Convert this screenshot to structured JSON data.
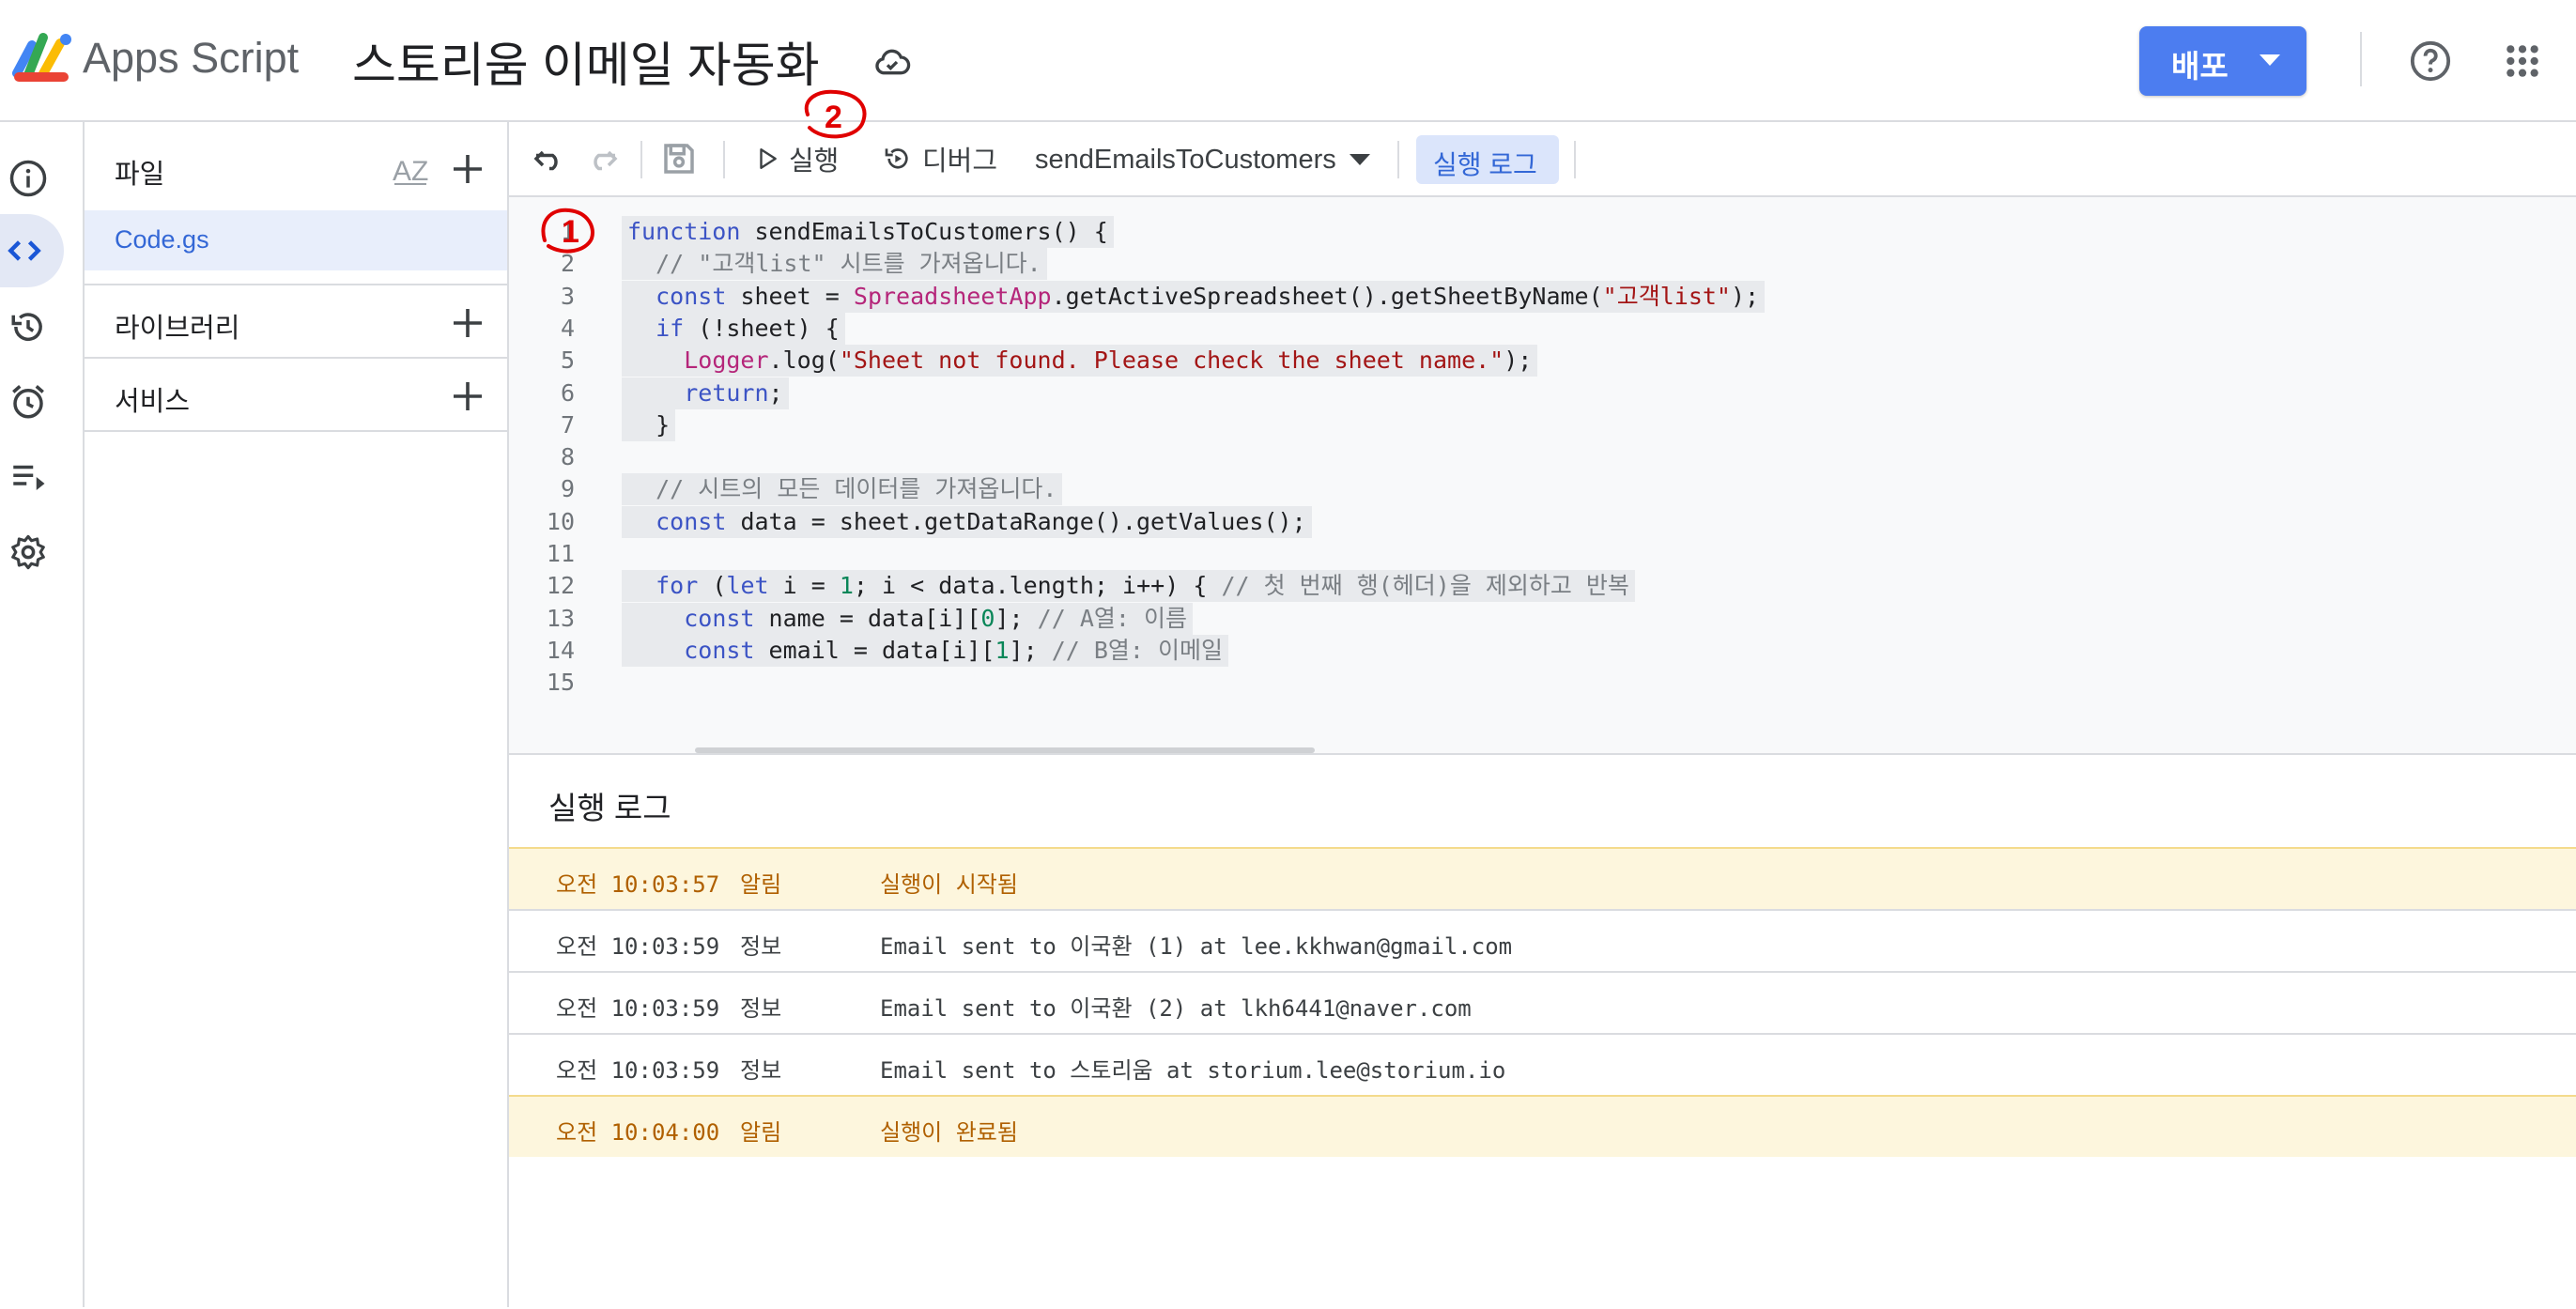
{
  "header": {
    "app_name": "Apps Script",
    "project_title": "스토리움 이메일 자동화",
    "deploy_label": "배포"
  },
  "icons": {
    "logo": "apps-script-logo",
    "cloud": "cloud-saved-icon",
    "help": "help-icon",
    "apps": "google-apps-grid-icon"
  },
  "files_panel": {
    "files_label": "파일",
    "files": [
      {
        "name": "Code.gs",
        "selected": true
      }
    ],
    "libraries_label": "라이브러리",
    "services_label": "서비스"
  },
  "toolbar": {
    "run_label": "실행",
    "debug_label": "디버그",
    "function_name": "sendEmailsToCustomers",
    "exec_log_label": "실행 로그"
  },
  "code": {
    "line_numbers": [
      "1",
      "2",
      "3",
      "4",
      "5",
      "6",
      "7",
      "8",
      "9",
      "10",
      "11",
      "12",
      "13",
      "14",
      "15"
    ],
    "lines": [
      "function sendEmailsToCustomers() {",
      "  // \"고객list\" 시트를 가져옵니다.",
      "  const sheet = SpreadsheetApp.getActiveSpreadsheet().getSheetByName(\"고객list\");",
      "  if (!sheet) {",
      "    Logger.log(\"Sheet not found. Please check the sheet name.\");",
      "    return;",
      "  }",
      "",
      "  // 시트의 모든 데이터를 가져옵니다.",
      "  const data = sheet.getDataRange().getValues();",
      "",
      "  for (let i = 1; i < data.length; i++) { // 첫 번째 행(헤더)을 제외하고 반복",
      "    const name = data[i][0]; // A열: 이름",
      "    const email = data[i][1]; // B열: 이메일",
      ""
    ]
  },
  "log": {
    "title": "실행 로그",
    "entries": [
      {
        "time": "오전 10:03:57",
        "level": "알림",
        "message": "실행이 시작됨",
        "type": "notice"
      },
      {
        "time": "오전 10:03:59",
        "level": "정보",
        "message": "Email sent to 이국환 (1) at lee.kkhwan@gmail.com",
        "type": "info"
      },
      {
        "time": "오전 10:03:59",
        "level": "정보",
        "message": "Email sent to 이국환 (2) at lkh6441@naver.com",
        "type": "info"
      },
      {
        "time": "오전 10:03:59",
        "level": "정보",
        "message": "Email sent to 스토리움 at storium.lee@storium.io",
        "type": "info"
      },
      {
        "time": "오전 10:04:00",
        "level": "알림",
        "message": "실행이 완료됨",
        "type": "notice"
      }
    ]
  },
  "annotations": [
    {
      "text": "1",
      "color": "#e00000"
    },
    {
      "text": "2",
      "color": "#e00000"
    }
  ],
  "colors": {
    "accent": "#4c7df0",
    "selected_file_bg": "#e8eefb",
    "notice_row_bg": "#fdf6dd",
    "annotation": "#e00000"
  }
}
